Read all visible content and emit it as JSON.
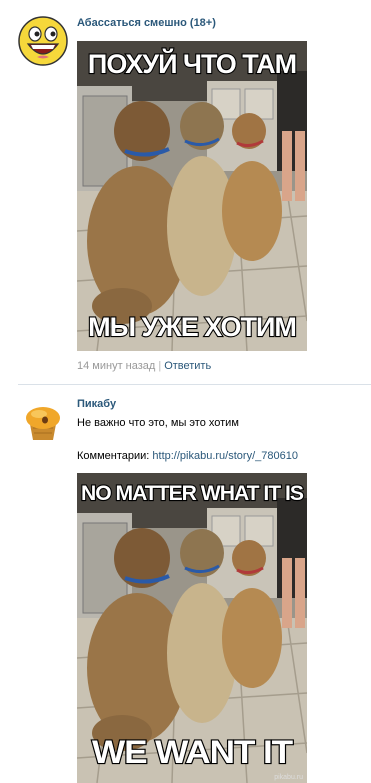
{
  "posts": [
    {
      "author": "Абассаться смешно (18+)",
      "avatar_icon": "awesome-smiley-face-icon",
      "image": {
        "top_caption": "ПОХУЙ ЧТО ТАМ",
        "bottom_caption": "МЫ УЖЕ ХОТИМ"
      },
      "timestamp": "14 минут назад",
      "separator": "|",
      "reply_label": "Ответить"
    },
    {
      "author": "Пикабу",
      "avatar_icon": "pikabu-cupcake-logo-icon",
      "text": "Не важно что это, мы это хотим",
      "comments_label": "Комментарии:",
      "comments_link": "http://pikabu.ru/story/_780610",
      "image": {
        "top_caption": "NO MATTER WHAT IT IS",
        "bottom_caption": "WE WANT IT",
        "watermark": "pikabu.ru"
      }
    }
  ],
  "colors": {
    "link": "#2b587a",
    "meta": "#999999",
    "divider": "#dae1e8"
  }
}
